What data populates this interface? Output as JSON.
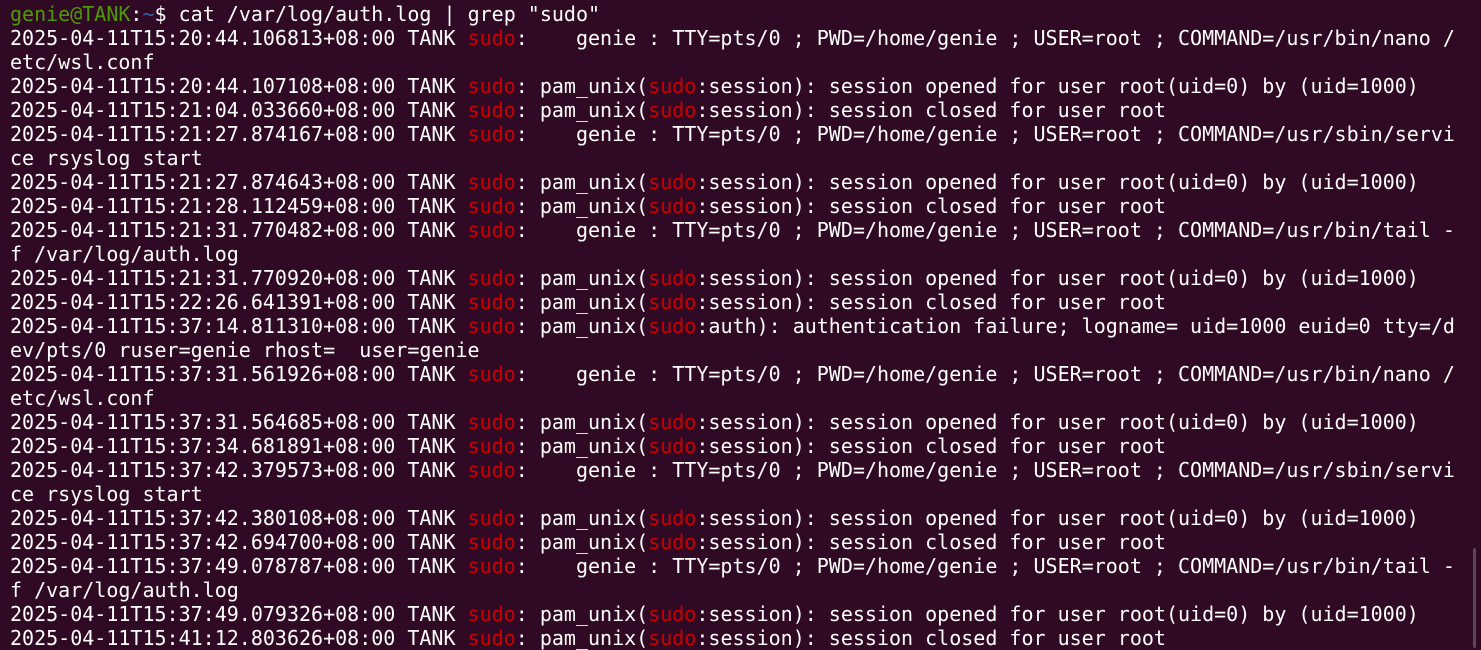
{
  "prompt": {
    "user_host": "genie@TANK",
    "colon": ":",
    "path": "~",
    "symbol": "$ ",
    "command": "cat /var/log/auth.log | grep \"sudo\""
  },
  "highlight_term": "sudo",
  "colors": {
    "background": "#300a24",
    "text": "#ffffff",
    "prompt_user": "#4e9a06",
    "prompt_path": "#3465a4",
    "match_highlight": "#cc0000"
  },
  "output_lines": [
    "2025-04-11T15:20:44.106813+08:00 TANK sudo:    genie : TTY=pts/0 ; PWD=/home/genie ; USER=root ; COMMAND=/usr/bin/nano /",
    "etc/wsl.conf",
    "2025-04-11T15:20:44.107108+08:00 TANK sudo: pam_unix(sudo:session): session opened for user root(uid=0) by (uid=1000)",
    "2025-04-11T15:21:04.033660+08:00 TANK sudo: pam_unix(sudo:session): session closed for user root",
    "2025-04-11T15:21:27.874167+08:00 TANK sudo:    genie : TTY=pts/0 ; PWD=/home/genie ; USER=root ; COMMAND=/usr/sbin/servi",
    "ce rsyslog start",
    "2025-04-11T15:21:27.874643+08:00 TANK sudo: pam_unix(sudo:session): session opened for user root(uid=0) by (uid=1000)",
    "2025-04-11T15:21:28.112459+08:00 TANK sudo: pam_unix(sudo:session): session closed for user root",
    "2025-04-11T15:21:31.770482+08:00 TANK sudo:    genie : TTY=pts/0 ; PWD=/home/genie ; USER=root ; COMMAND=/usr/bin/tail -",
    "f /var/log/auth.log",
    "2025-04-11T15:21:31.770920+08:00 TANK sudo: pam_unix(sudo:session): session opened for user root(uid=0) by (uid=1000)",
    "2025-04-11T15:22:26.641391+08:00 TANK sudo: pam_unix(sudo:session): session closed for user root",
    "2025-04-11T15:37:14.811310+08:00 TANK sudo: pam_unix(sudo:auth): authentication failure; logname= uid=1000 euid=0 tty=/d",
    "ev/pts/0 ruser=genie rhost=  user=genie",
    "2025-04-11T15:37:31.561926+08:00 TANK sudo:    genie : TTY=pts/0 ; PWD=/home/genie ; USER=root ; COMMAND=/usr/bin/nano /",
    "etc/wsl.conf",
    "2025-04-11T15:37:31.564685+08:00 TANK sudo: pam_unix(sudo:session): session opened for user root(uid=0) by (uid=1000)",
    "2025-04-11T15:37:34.681891+08:00 TANK sudo: pam_unix(sudo:session): session closed for user root",
    "2025-04-11T15:37:42.379573+08:00 TANK sudo:    genie : TTY=pts/0 ; PWD=/home/genie ; USER=root ; COMMAND=/usr/sbin/servi",
    "ce rsyslog start",
    "2025-04-11T15:37:42.380108+08:00 TANK sudo: pam_unix(sudo:session): session opened for user root(uid=0) by (uid=1000)",
    "2025-04-11T15:37:42.694700+08:00 TANK sudo: pam_unix(sudo:session): session closed for user root",
    "2025-04-11T15:37:49.078787+08:00 TANK sudo:    genie : TTY=pts/0 ; PWD=/home/genie ; USER=root ; COMMAND=/usr/bin/tail -",
    "f /var/log/auth.log",
    "2025-04-11T15:37:49.079326+08:00 TANK sudo: pam_unix(sudo:session): session opened for user root(uid=0) by (uid=1000)",
    "2025-04-11T15:41:12.803626+08:00 TANK sudo: pam_unix(sudo:session): session closed for user root"
  ]
}
